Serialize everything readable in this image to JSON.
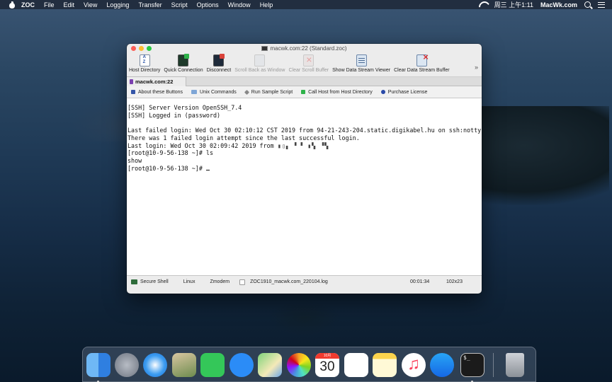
{
  "menubar": {
    "app_name": "ZOC",
    "items": [
      "File",
      "Edit",
      "View",
      "Logging",
      "Transfer",
      "Script",
      "Options",
      "Window",
      "Help"
    ],
    "clock": "周三 上午1:11",
    "site": "MacWk.com"
  },
  "window": {
    "title": "macwk.com:22 (Standard.zoc)",
    "toolbar": [
      {
        "label": "Host Directory",
        "icon": "host-directory-icon",
        "enabled": true
      },
      {
        "label": "Quick Connection",
        "icon": "quick-connection-icon",
        "enabled": true
      },
      {
        "label": "Disconnect",
        "icon": "disconnect-icon",
        "enabled": true
      },
      {
        "label": "Scroll Back as Window",
        "icon": "scroll-back-icon",
        "enabled": false
      },
      {
        "label": "Clear Scroll Buffer",
        "icon": "clear-scroll-buffer-icon",
        "enabled": false
      },
      {
        "label": "Show Data Stream Viewer",
        "icon": "data-stream-viewer-icon",
        "enabled": true
      },
      {
        "label": "Clear Data Stream Buffer",
        "icon": "clear-data-stream-icon",
        "enabled": true
      }
    ],
    "overflow": "»",
    "tab_label": "macwk.com:22",
    "buttonbar": [
      "About these Buttons",
      "Unix Commands",
      "Run Sample Script",
      "Call Host from Host Directory",
      "Purchase License"
    ],
    "terminal": {
      "line1": "[SSH] Server Version OpenSSH_7.4",
      "line2": "[SSH] Logged in (password)",
      "line3": "",
      "line4": "Last failed login: Wed Oct 30 02:10:12 CST 2019 from 94-21-243-204.static.digikabel.hu on ssh:notty",
      "line5": "There was 1 failed login attempt since the last successful login.",
      "line6_prefix": "Last login: Wed Oct 30 02:09:42 2019 from ",
      "line6_masked": "▮▯▖ ▘▝ ▮▚ ▝▚",
      "line7": "[root@10-9-56-138 ~]# ls",
      "line8": "show",
      "line9": "[root@10-9-56-138 ~]# "
    },
    "status": {
      "protocol": "Secure Shell",
      "emulation": "Linux",
      "transfer": "Zmodem",
      "log_file": "ZOC1910_macwk.com_220104.log",
      "elapsed": "00:01:34",
      "size": "102x23"
    }
  },
  "dock": {
    "calendar_month": "10月",
    "calendar_day": "30",
    "apps": [
      "Finder",
      "Launchpad",
      "Safari",
      "Preview",
      "FaceTime",
      "Messages",
      "Maps",
      "Photos",
      "Calendar",
      "Reminders",
      "Notes",
      "Music",
      "App Store",
      "Terminal",
      "Trash"
    ]
  }
}
